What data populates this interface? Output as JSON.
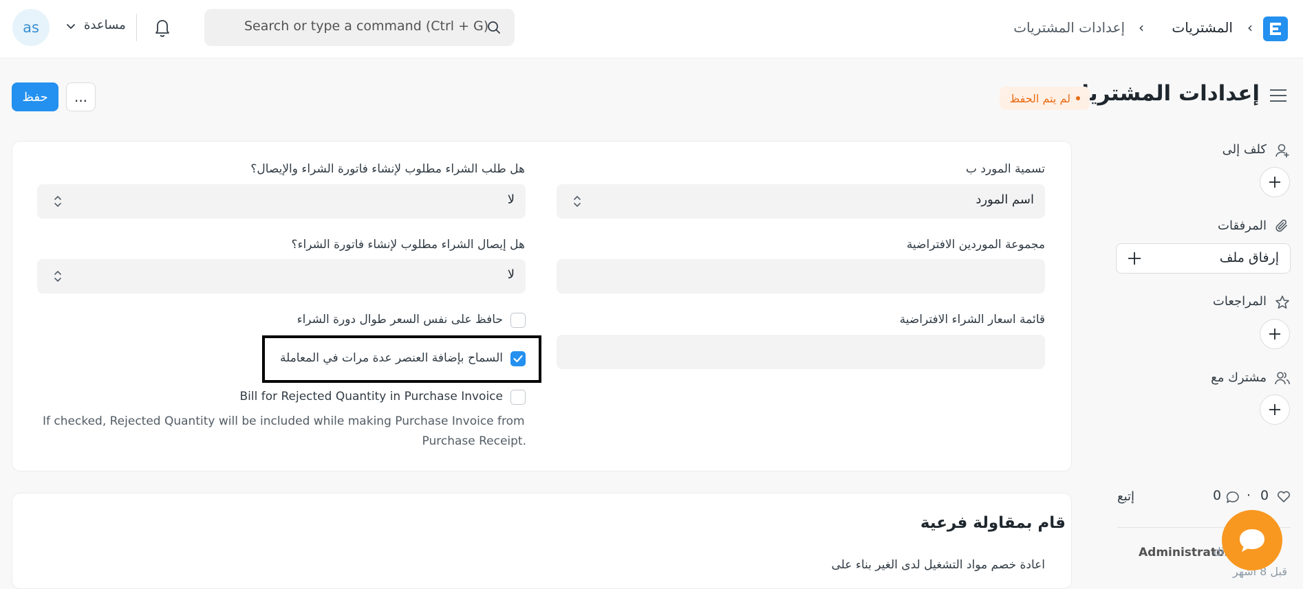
{
  "navbar": {
    "breadcrumbs": [
      "المشتريات",
      "إعدادات المشتريات"
    ],
    "search_placeholder": "Search or type a command (Ctrl + G)",
    "help_label": "مساعدة",
    "avatar_initials": "as"
  },
  "page": {
    "title": "إعدادات المشتريات",
    "status": "لم يتم الحفظ",
    "more_label": "...",
    "save_label": "حفظ"
  },
  "sidebar": {
    "assign_label": "كلف إلى",
    "attachments_label": "المرفقات",
    "attach_file_label": "إرفاق ملف",
    "reviews_label": "المراجعات",
    "shared_label": "مشترك مع",
    "likes": "0",
    "comments": "0",
    "separator": "·",
    "follow_label": "إتبع",
    "activity_user": "Administrator",
    "activity_trail": "dis",
    "activity_time": "قبل 8 أشهر"
  },
  "form": {
    "supplier_naming": {
      "label": "تسمية المورد ب",
      "value": "اسم المورد"
    },
    "po_required": {
      "label": "هل طلب الشراء مطلوب لإنشاء فاتورة الشراء والإيصال؟",
      "value": "لا"
    },
    "default_supplier_group": {
      "label": "مجموعة الموردين الافتراضية",
      "value": ""
    },
    "pr_required": {
      "label": "هل إيصال الشراء مطلوب لإنشاء فاتورة الشراء؟",
      "value": "لا"
    },
    "default_price_list": {
      "label": "قائمة اسعار الشراء الافتراضية",
      "value": ""
    },
    "maintain_rate": {
      "label": "حافظ على نفس السعر طوال دورة الشراء",
      "checked": false
    },
    "allow_multiple_items": {
      "label": "السماح بإضافة العنصر عدة مرات في المعاملة",
      "checked": true
    },
    "bill_rejected": {
      "label": "Bill for Rejected Quantity in Purchase Invoice",
      "checked": false
    },
    "bill_rejected_desc_1": "If checked, Rejected Quantity will be included while making Purchase Invoice from",
    "bill_rejected_desc_2": "Purchase Receipt."
  },
  "subcontract": {
    "title": "قام بمقاولة فرعية",
    "backflush_label": "اعادة خصم مواد التشغيل لدى الغير بناء على"
  },
  "colors": {
    "accent": "#2490ef",
    "unsaved": "#e86c13",
    "chat": "#f89820"
  }
}
